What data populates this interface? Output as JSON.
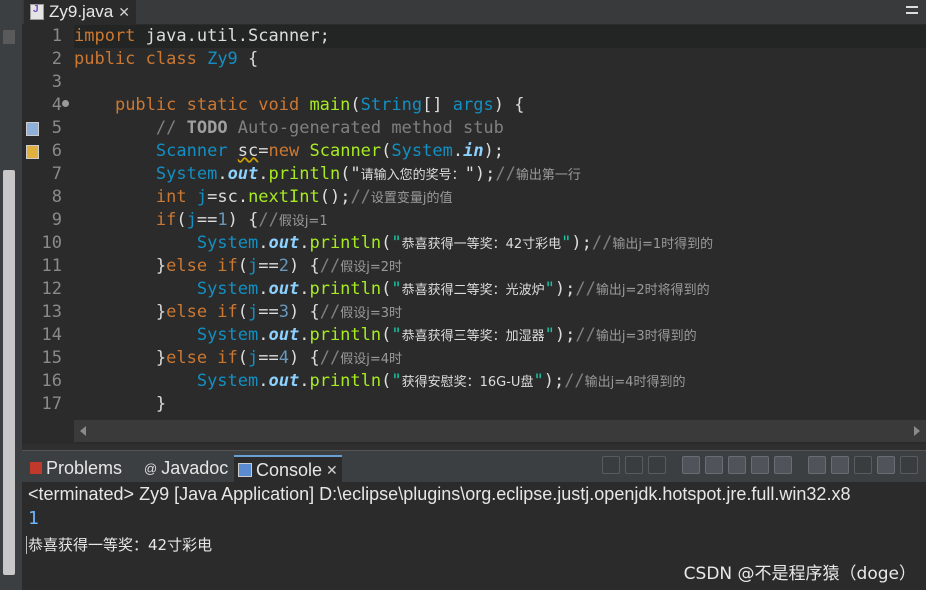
{
  "editor_tab": {
    "filename": "Zy9.java",
    "close": "✕"
  },
  "code_lines": [
    {
      "num": "1",
      "parts": [
        [
          "kw",
          "import"
        ],
        [
          "var",
          " java.util.Scanner;"
        ]
      ]
    },
    {
      "num": "2",
      "parts": [
        [
          "kw",
          "public class"
        ],
        [
          "var",
          " "
        ],
        [
          "cls",
          "Zy9"
        ],
        [
          "var",
          " {"
        ]
      ]
    },
    {
      "num": "3",
      "parts": []
    },
    {
      "num": "4",
      "parts": [
        [
          "var",
          "    "
        ],
        [
          "kw",
          "public static void"
        ],
        [
          "var",
          " "
        ],
        [
          "mtd",
          "main"
        ],
        [
          "var",
          "("
        ],
        [
          "cls",
          "String"
        ],
        [
          "var",
          "[] "
        ],
        [
          "cls",
          "args"
        ],
        [
          "var",
          ") {"
        ]
      ]
    },
    {
      "num": "5",
      "parts": [
        [
          "var",
          "        "
        ],
        [
          "cmt",
          "// "
        ],
        [
          "todo",
          "TODO"
        ],
        [
          "cmt",
          " Auto-generated method stub"
        ]
      ]
    },
    {
      "num": "6",
      "parts": [
        [
          "var",
          "        "
        ],
        [
          "cls",
          "Scanner"
        ],
        [
          "var",
          " "
        ],
        [
          "uvar",
          "sc"
        ],
        [
          "var",
          "="
        ],
        [
          "kw",
          "new"
        ],
        [
          "var",
          " "
        ],
        [
          "mtd",
          "Scanner"
        ],
        [
          "var",
          "("
        ],
        [
          "cls",
          "System"
        ],
        [
          "var",
          "."
        ],
        [
          "fld",
          "in"
        ],
        [
          "var",
          ");"
        ]
      ]
    },
    {
      "num": "7",
      "parts": [
        [
          "var",
          "        "
        ],
        [
          "cls",
          "System"
        ],
        [
          "var",
          "."
        ],
        [
          "fld",
          "out"
        ],
        [
          "var",
          "."
        ],
        [
          "mtd",
          "println"
        ],
        [
          "var",
          "(\""
        ],
        [
          "cn",
          "请输入您的奖号："
        ],
        [
          "var",
          "\");"
        ],
        [
          "cmt",
          "//"
        ],
        [
          "cmtcn",
          "输出第一行"
        ]
      ]
    },
    {
      "num": "8",
      "parts": [
        [
          "var",
          "        "
        ],
        [
          "kw",
          "int"
        ],
        [
          "var",
          " "
        ],
        [
          "cls",
          "j"
        ],
        [
          "var",
          "=sc."
        ],
        [
          "mtd",
          "nextInt"
        ],
        [
          "var",
          "();"
        ],
        [
          "cmt",
          "//"
        ],
        [
          "cmtcn",
          "设置变量j的值"
        ]
      ]
    },
    {
      "num": "9",
      "parts": [
        [
          "var",
          "        "
        ],
        [
          "kw",
          "if"
        ],
        [
          "var",
          "("
        ],
        [
          "cls",
          "j"
        ],
        [
          "var",
          "=="
        ],
        [
          "num",
          "1"
        ],
        [
          "var",
          ") {"
        ],
        [
          "cmt",
          "//"
        ],
        [
          "cmtcn",
          "假设j=1"
        ]
      ]
    },
    {
      "num": "10",
      "parts": [
        [
          "var",
          "            "
        ],
        [
          "cls",
          "System"
        ],
        [
          "var",
          "."
        ],
        [
          "fld",
          "out"
        ],
        [
          "var",
          "."
        ],
        [
          "mtd",
          "println"
        ],
        [
          "var",
          "("
        ],
        [
          "str",
          "\""
        ],
        [
          "cn",
          "恭喜获得一等奖：42寸彩电"
        ],
        [
          "str",
          "\""
        ],
        [
          "var",
          ");"
        ],
        [
          "cmt",
          "//"
        ],
        [
          "cmtcn",
          "输出j=1时得到的"
        ]
      ]
    },
    {
      "num": "11",
      "parts": [
        [
          "var",
          "        }"
        ],
        [
          "kw",
          "else if"
        ],
        [
          "var",
          "("
        ],
        [
          "cls",
          "j"
        ],
        [
          "var",
          "=="
        ],
        [
          "num",
          "2"
        ],
        [
          "var",
          ") {"
        ],
        [
          "cmt",
          "//"
        ],
        [
          "cmtcn",
          "假设j=2时"
        ]
      ]
    },
    {
      "num": "12",
      "parts": [
        [
          "var",
          "            "
        ],
        [
          "cls",
          "System"
        ],
        [
          "var",
          "."
        ],
        [
          "fld",
          "out"
        ],
        [
          "var",
          "."
        ],
        [
          "mtd",
          "println"
        ],
        [
          "var",
          "("
        ],
        [
          "str",
          "\""
        ],
        [
          "cn",
          "恭喜获得二等奖：光波炉"
        ],
        [
          "str",
          "\""
        ],
        [
          "var",
          ");"
        ],
        [
          "cmt",
          "//"
        ],
        [
          "cmtcn",
          "输出j=2时将得到的"
        ]
      ]
    },
    {
      "num": "13",
      "parts": [
        [
          "var",
          "        }"
        ],
        [
          "kw",
          "else if"
        ],
        [
          "var",
          "("
        ],
        [
          "cls",
          "j"
        ],
        [
          "var",
          "=="
        ],
        [
          "num",
          "3"
        ],
        [
          "var",
          ") {"
        ],
        [
          "cmt",
          "//"
        ],
        [
          "cmtcn",
          "假设j=3时"
        ]
      ]
    },
    {
      "num": "14",
      "parts": [
        [
          "var",
          "            "
        ],
        [
          "cls",
          "System"
        ],
        [
          "var",
          "."
        ],
        [
          "fld",
          "out"
        ],
        [
          "var",
          "."
        ],
        [
          "mtd",
          "println"
        ],
        [
          "var",
          "("
        ],
        [
          "str",
          "\""
        ],
        [
          "cn",
          "恭喜获得三等奖：加湿器"
        ],
        [
          "str",
          "\""
        ],
        [
          "var",
          ");"
        ],
        [
          "cmt",
          "//"
        ],
        [
          "cmtcn",
          "输出j=3时得到的"
        ]
      ]
    },
    {
      "num": "15",
      "parts": [
        [
          "var",
          "        }"
        ],
        [
          "kw",
          "else if"
        ],
        [
          "var",
          "("
        ],
        [
          "cls",
          "j"
        ],
        [
          "var",
          "=="
        ],
        [
          "num",
          "4"
        ],
        [
          "var",
          ") {"
        ],
        [
          "cmt",
          "//"
        ],
        [
          "cmtcn",
          "假设j=4时"
        ]
      ]
    },
    {
      "num": "16",
      "parts": [
        [
          "var",
          "            "
        ],
        [
          "cls",
          "System"
        ],
        [
          "var",
          "."
        ],
        [
          "fld",
          "out"
        ],
        [
          "var",
          "."
        ],
        [
          "mtd",
          "println"
        ],
        [
          "var",
          "("
        ],
        [
          "str",
          "\""
        ],
        [
          "cn",
          "获得安慰奖：16G-U盘"
        ],
        [
          "str",
          "\""
        ],
        [
          "var",
          ");"
        ],
        [
          "cmt",
          "//"
        ],
        [
          "cmtcn",
          "输出j=4时得到的"
        ]
      ]
    },
    {
      "num": "17",
      "parts": [
        [
          "var",
          "        }"
        ]
      ]
    }
  ],
  "panel": {
    "tabs": [
      {
        "label": "Problems",
        "icon": "problems-icon"
      },
      {
        "label": "Javadoc",
        "icon": "javadoc-icon"
      },
      {
        "label": "Console",
        "icon": "console-icon"
      }
    ],
    "console_close": "✕"
  },
  "console": {
    "terminated_line": "<terminated> Zy9 [Java Application] D:\\eclipse\\plugins\\org.eclipse.justj.openjdk.hotspot.jre.full.win32.x8",
    "input_echo": "1",
    "output_line": "恭喜获得一等奖：42寸彩电"
  },
  "watermark": "CSDN @不是程序猿（doge）",
  "colors": {
    "keyword": "#cc7832",
    "class": "#1290c3",
    "method": "#a7ec21",
    "string": "#17c6a3",
    "comment": "#808080"
  }
}
